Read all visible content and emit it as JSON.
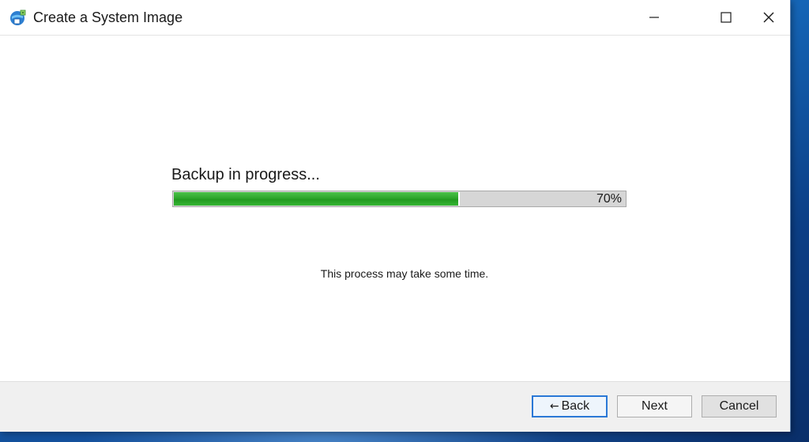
{
  "window": {
    "title": "Create a System Image",
    "icon": "system-image-backup-icon",
    "controls": {
      "minimize": "minimize-icon",
      "maximize": "maximize-icon",
      "close": "close-icon"
    }
  },
  "main": {
    "heading": "Backup in progress...",
    "progress": {
      "value": 0.7,
      "label": "70%",
      "fill_color": "#2ea62c"
    },
    "note": "This process may take some time."
  },
  "footer": {
    "back_arrow": "←",
    "back_label": "Back",
    "next_label": "Next",
    "cancel_label": "Cancel"
  },
  "colors": {
    "accent": "#2a78d6",
    "desktop": "#1565b6"
  }
}
